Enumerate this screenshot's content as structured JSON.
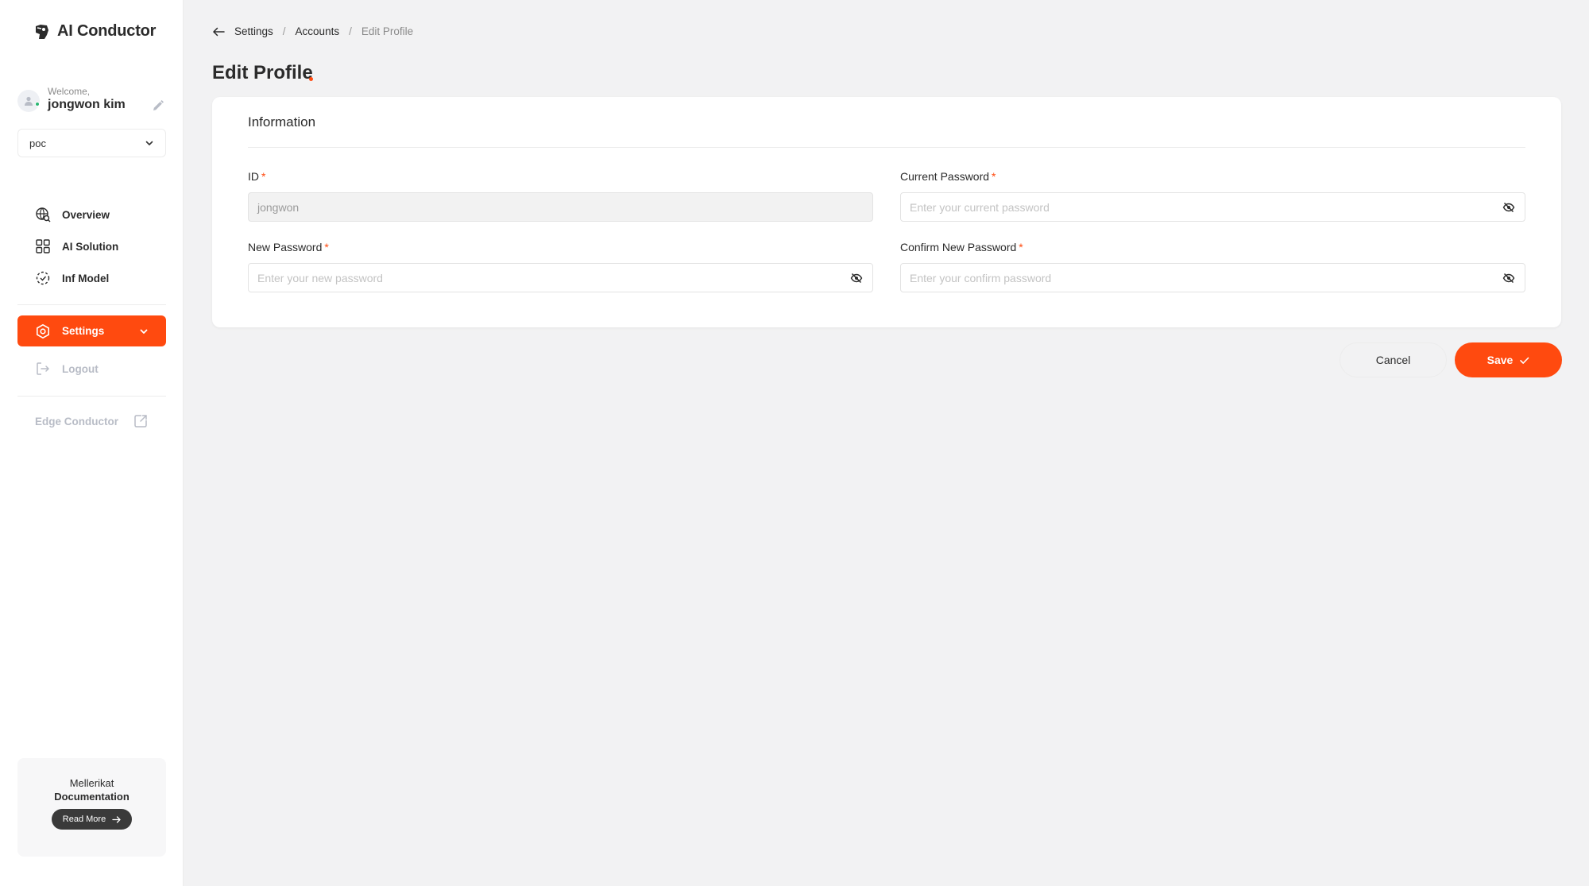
{
  "app": {
    "brand": "AI Conductor"
  },
  "user": {
    "welcome": "Welcome,",
    "name": "jongwon kim"
  },
  "project": {
    "selected": "poc"
  },
  "nav": {
    "items": [
      {
        "label": "Overview",
        "icon": "globe-search-icon"
      },
      {
        "label": "AI Solution",
        "icon": "grid-icon"
      },
      {
        "label": "Inf Model",
        "icon": "dashed-circle-icon"
      }
    ],
    "settings": "Settings",
    "logout": "Logout",
    "edge": "Edge Conductor"
  },
  "doc_card": {
    "line1": "Mellerikat",
    "line2": "Documentation",
    "button": "Read More"
  },
  "breadcrumb": {
    "items": [
      "Settings",
      "Accounts",
      "Edit Profile"
    ],
    "sep": "/"
  },
  "page": {
    "title": "Edit Profile"
  },
  "form": {
    "section_title": "Information",
    "required_mark": "*",
    "id": {
      "label": "ID",
      "value": "jongwon"
    },
    "current_password": {
      "label": "Current Password",
      "placeholder": "Enter your current password"
    },
    "new_password": {
      "label": "New Password",
      "placeholder": "Enter your new password"
    },
    "confirm_password": {
      "label": "Confirm New Password",
      "placeholder": "Enter your confirm password"
    }
  },
  "actions": {
    "cancel": "Cancel",
    "save": "Save"
  },
  "colors": {
    "accent": "#ff4a0f",
    "background": "#f2f2f3"
  }
}
